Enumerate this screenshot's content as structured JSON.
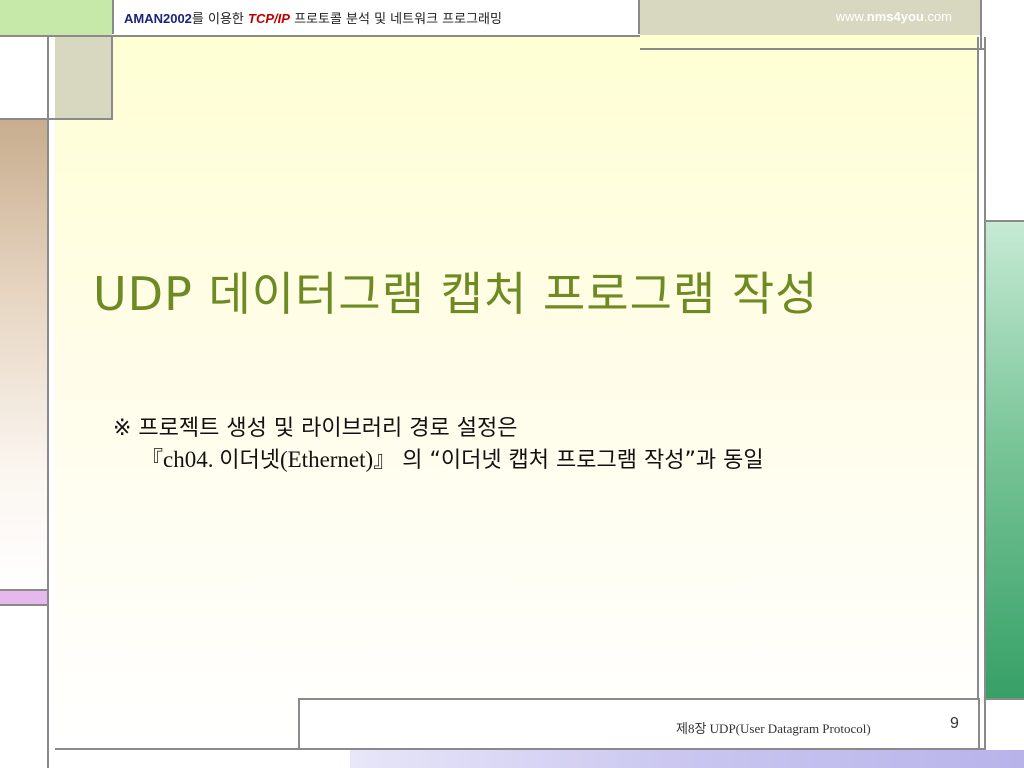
{
  "header": {
    "brand": "AMAN2002",
    "text_a": "를 이용한 ",
    "tcp": "TCP/IP",
    "text_b": " 프로토콜 분석 및 네트워크 프로그래밍",
    "site_prefix": "www.",
    "site_domain": "nms4you",
    "site_suffix": ".com"
  },
  "slide": {
    "title": "UDP 데이터그램 캡처 프로그램 작성",
    "line1": "※ 프로젝트 생성 및 라이브러리 경로 설정은",
    "line2_open": "『",
    "line2_ref": "ch04. ",
    "line2_ko": "이더넷",
    "line2_eth": "(Ethernet)",
    "line2_close": "』",
    "line2_rest": " 의 “이더넷 캡처 프로그램 작성”과 동일"
  },
  "footer": {
    "chapter": "제8장  UDP(User Datagram Protocol)",
    "page_number": "9"
  },
  "colors": {
    "title": "#6e8a22",
    "brand": "#1a237e",
    "tcp": "#c00000"
  }
}
